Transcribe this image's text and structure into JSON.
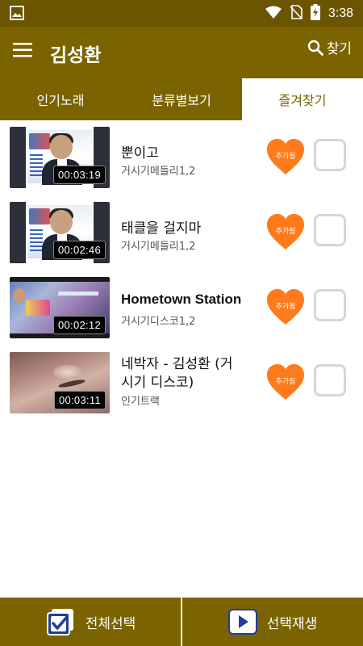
{
  "status_bar": {
    "time": "3:38",
    "icons": [
      "image-icon",
      "wifi-icon",
      "no-sim-icon",
      "battery-charging-icon"
    ]
  },
  "app_bar": {
    "title": "김성환",
    "search_label": "찾기",
    "icons": [
      "menu-icon",
      "search-icon"
    ]
  },
  "tabs": [
    {
      "label": "인기노래",
      "active": false
    },
    {
      "label": "분류별보기",
      "active": false
    },
    {
      "label": "즐겨찾기",
      "active": true
    }
  ],
  "songs": [
    {
      "title": "뿐이고",
      "subtitle": "거시기메들리1,2",
      "duration": "00:03:19",
      "favorite_label": "추가됨",
      "checked": false
    },
    {
      "title": "태클을 걸지마",
      "subtitle": "거시기메들리1,2",
      "duration": "00:02:46",
      "favorite_label": "추가됨",
      "checked": false
    },
    {
      "title": "Hometown Station",
      "subtitle": "거시기디스코1,2",
      "duration": "00:02:12",
      "favorite_label": "추가됨",
      "checked": false
    },
    {
      "title_line1": "네박자  - 김성환 (거",
      "title_line2": "시기 디스코)",
      "subtitle": "인기트랙",
      "duration": "00:03:11",
      "favorite_label": "추가됨",
      "checked": false
    }
  ],
  "bottom_bar": {
    "select_all_label": "전체선택",
    "play_selected_label": "선택재생"
  },
  "colors": {
    "primary": "#7b6300",
    "status_bar": "#6b5500",
    "heart": "#ff7a1a",
    "checkbox_border": "#d6d6d6"
  }
}
